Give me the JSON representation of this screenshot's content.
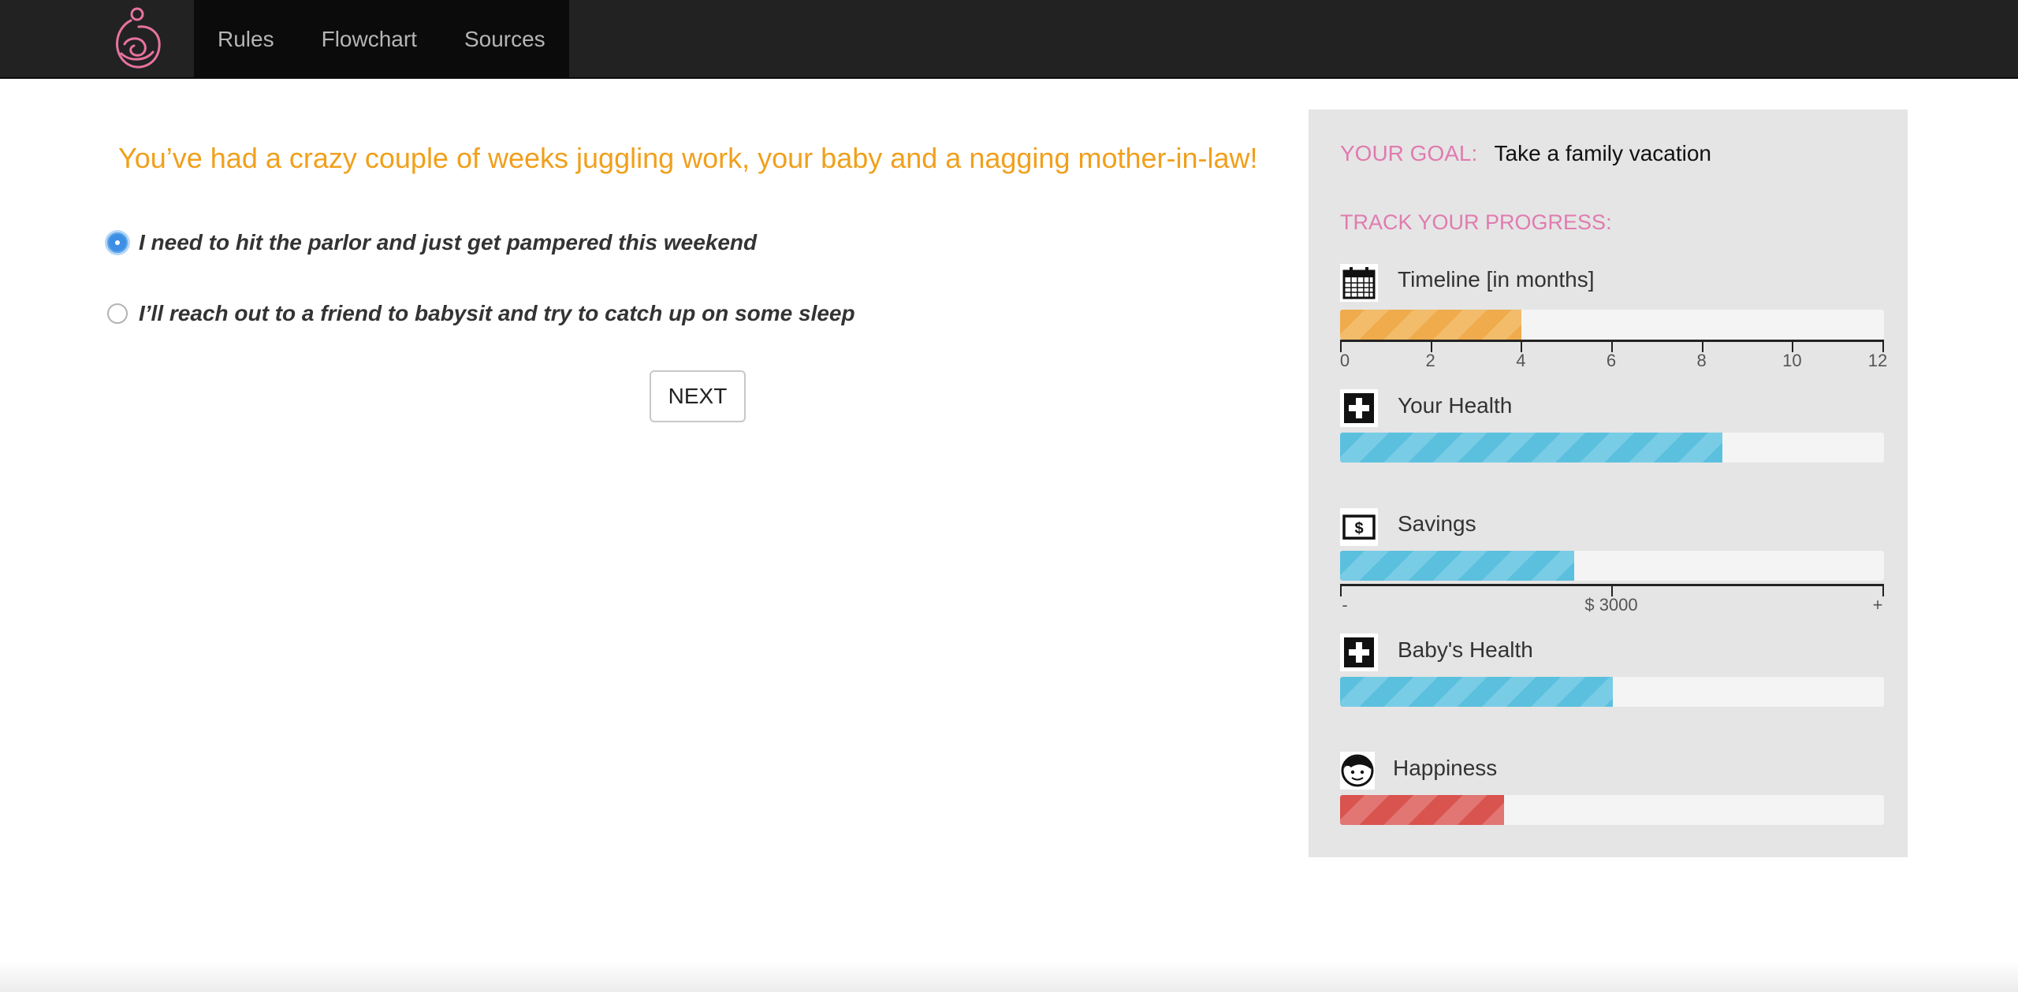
{
  "nav": {
    "logo_icon": "mother-baby-logo-icon",
    "links": [
      "Rules",
      "Flowchart",
      "Sources"
    ]
  },
  "question": {
    "text": "You’ve had a crazy couple of weeks juggling work, your baby and a nagging mother-in-law!",
    "options": [
      {
        "label": "I need to hit the parlor and just get pampered this weekend",
        "selected": true
      },
      {
        "label": "I’ll reach out to a friend to babysit and try to catch up on some sleep",
        "selected": false
      }
    ],
    "next_label": "NEXT"
  },
  "panel": {
    "goal_label": "YOUR GOAL:",
    "goal_value": "Take a family vacation",
    "track_label": "TRACK YOUR PROGRESS:",
    "metrics": [
      {
        "title": "Timeline [in months]",
        "icon": "calendar-icon",
        "progress": 0.333,
        "color": "#efab4c",
        "axis": [
          "0",
          "2",
          "4",
          "6",
          "8",
          "10",
          "12"
        ]
      },
      {
        "title": "Your Health",
        "icon": "medical-cross-icon",
        "progress": 0.703,
        "color": "#5bc0de"
      },
      {
        "title": "Savings",
        "icon": "money-icon",
        "progress": 0.43,
        "color": "#5bc0de",
        "axis": [
          "-",
          "$ 3000",
          "+"
        ]
      },
      {
        "title": "Baby's Health",
        "icon": "medical-cross-icon",
        "progress": 0.502,
        "color": "#5bc0de"
      },
      {
        "title": "Happiness",
        "icon": "face-icon",
        "progress": 0.302,
        "color": "#d9534f"
      }
    ]
  },
  "colors": {
    "accent_orange": "#f0a01c",
    "accent_pink": "#e07bb0",
    "navbar": "#222222"
  }
}
